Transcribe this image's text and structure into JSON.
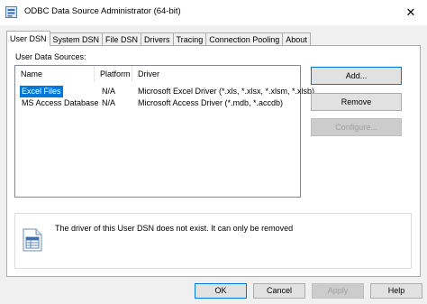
{
  "window": {
    "title": "ODBC Data Source Administrator (64-bit)",
    "close_glyph": "✕",
    "icon": "odbc-app-icon"
  },
  "tabs": [
    {
      "label": "User DSN",
      "active": true
    },
    {
      "label": "System DSN"
    },
    {
      "label": "File DSN"
    },
    {
      "label": "Drivers"
    },
    {
      "label": "Tracing"
    },
    {
      "label": "Connection Pooling"
    },
    {
      "label": "About"
    }
  ],
  "main": {
    "sources_label": "User Data Sources:",
    "columns": [
      "Name",
      "Platform",
      "Driver"
    ],
    "rows": [
      {
        "name": "Excel Files",
        "platform": "N/A",
        "driver": "Microsoft Excel Driver (*.xls, *.xlsx, *.xlsm, *.xlsb)",
        "selected": true
      },
      {
        "name": "MS Access Database",
        "platform": "N/A",
        "driver": "Microsoft Access Driver (*.mdb, *.accdb)"
      }
    ],
    "buttons": {
      "add": "Add...",
      "remove": "Remove",
      "configure": "Configure..."
    },
    "info": {
      "text": "The driver of this User DSN does not exist. It can only be removed",
      "icon": "document-info-icon"
    }
  },
  "footer": {
    "ok": "OK",
    "cancel": "Cancel",
    "apply": "Apply",
    "help": "Help"
  },
  "colors": {
    "accent": "#0078d7",
    "selection": "#0078d7"
  }
}
